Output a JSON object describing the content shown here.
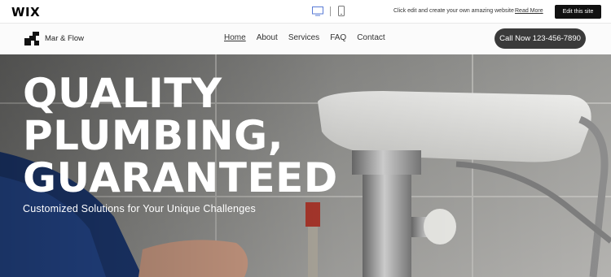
{
  "wixbar": {
    "logo": "WIX",
    "promo_text": "Click edit and create your own amazing website",
    "read_more": "Read More",
    "edit_button": "Edit this site",
    "icons": [
      "desktop-icon",
      "mobile-icon"
    ]
  },
  "header": {
    "brand_name": "Mar & Flow",
    "nav": [
      {
        "label": "Home",
        "active": true
      },
      {
        "label": "About"
      },
      {
        "label": "Services"
      },
      {
        "label": "FAQ"
      },
      {
        "label": "Contact"
      }
    ],
    "call_button": "Call Now 123-456-7890"
  },
  "hero": {
    "title_lines": [
      "QUALITY",
      "PLUMBING,",
      "GUARANTEED"
    ],
    "subtitle": "Customized Solutions for Your Unique Challenges"
  },
  "colors": {
    "accent_dark": "#3a3a3a",
    "edit_button": "#111111",
    "hero_text": "#ffffff"
  }
}
